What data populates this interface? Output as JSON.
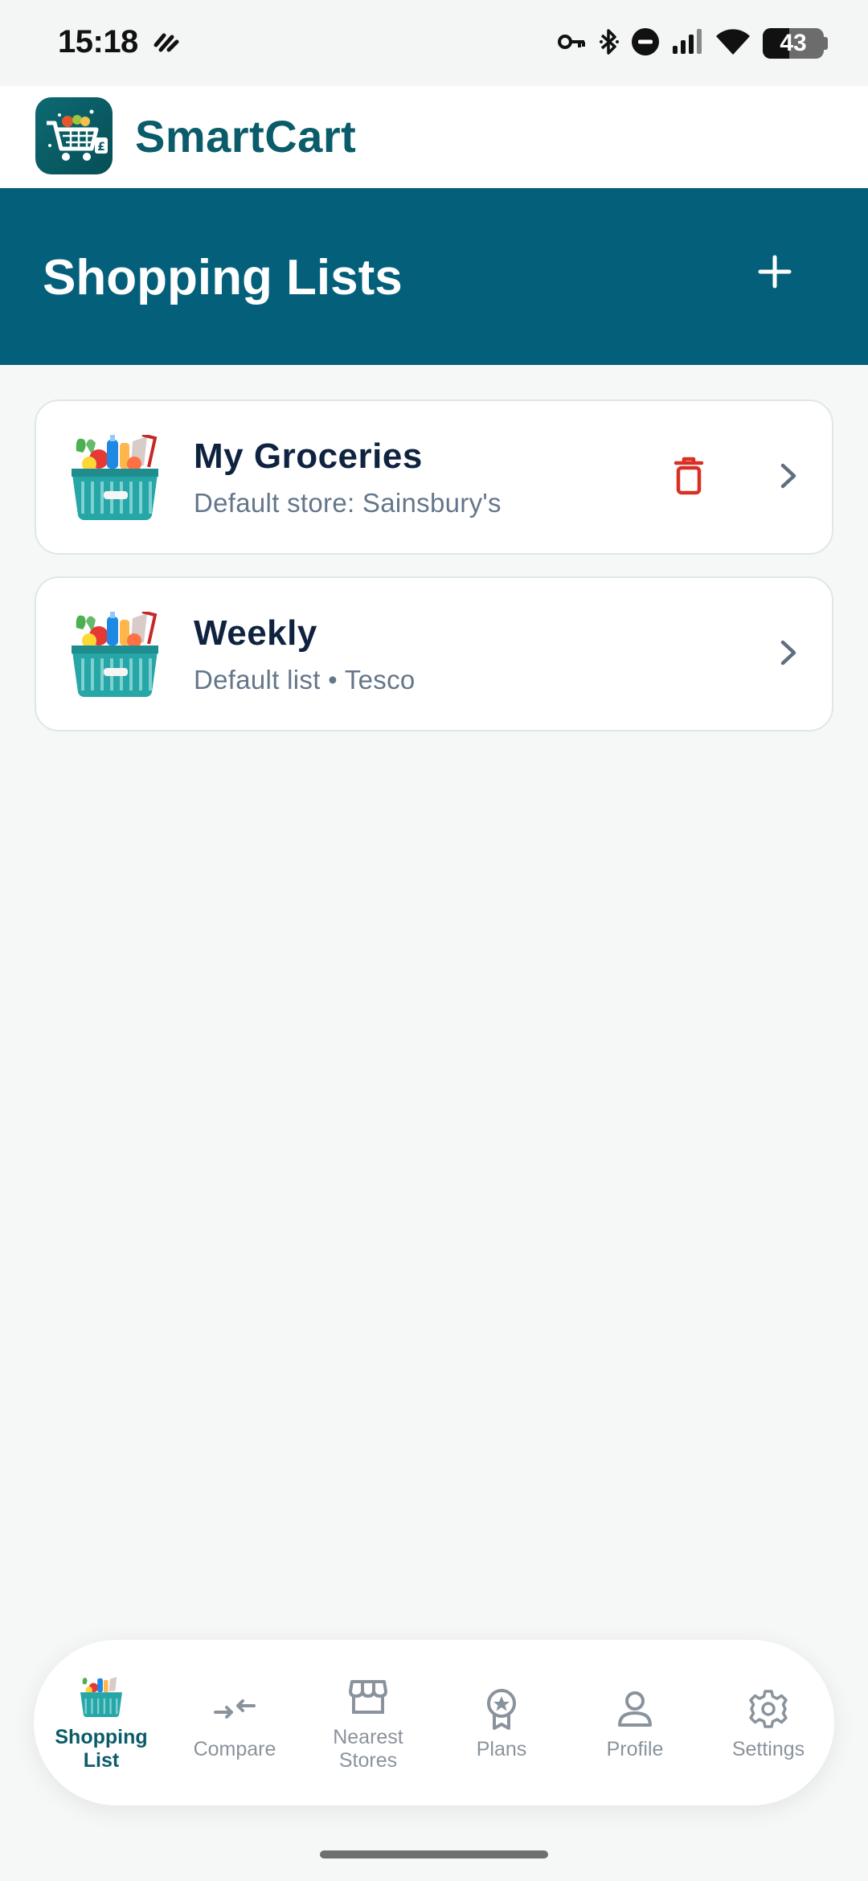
{
  "status_bar": {
    "time": "15:18",
    "battery_level": "43",
    "icons": [
      "vibrate-icon",
      "vpn-key-icon",
      "bluetooth-icon",
      "do-not-disturb-icon",
      "cell-signal-icon",
      "wifi-icon",
      "battery-icon"
    ]
  },
  "app": {
    "name": "SmartCart",
    "logo_icon": "cart-logo-icon"
  },
  "page": {
    "title": "Shopping Lists",
    "add_icon": "plus-icon"
  },
  "lists": [
    {
      "title": "My Groceries",
      "subtitle": "Default store: Sainsbury's",
      "thumb_icon": "grocery-basket-icon",
      "has_delete": true
    },
    {
      "title": "Weekly",
      "subtitle": "Default list • Tesco",
      "thumb_icon": "grocery-basket-icon",
      "has_delete": false
    }
  ],
  "bottom_nav": [
    {
      "label": "Shopping\nList",
      "icon": "grocery-basket-icon",
      "active": true
    },
    {
      "label": "Compare",
      "icon": "compare-arrows-icon",
      "active": false
    },
    {
      "label": "Nearest\nStores",
      "icon": "storefront-icon",
      "active": false
    },
    {
      "label": "Plans",
      "icon": "award-badge-icon",
      "active": false
    },
    {
      "label": "Profile",
      "icon": "person-icon",
      "active": false
    },
    {
      "label": "Settings",
      "icon": "gear-icon",
      "active": false
    }
  ],
  "colors": {
    "brand": "#04607a",
    "brand_text": "#0a5c6a",
    "delete": "#d93025",
    "muted": "#8a939c"
  }
}
